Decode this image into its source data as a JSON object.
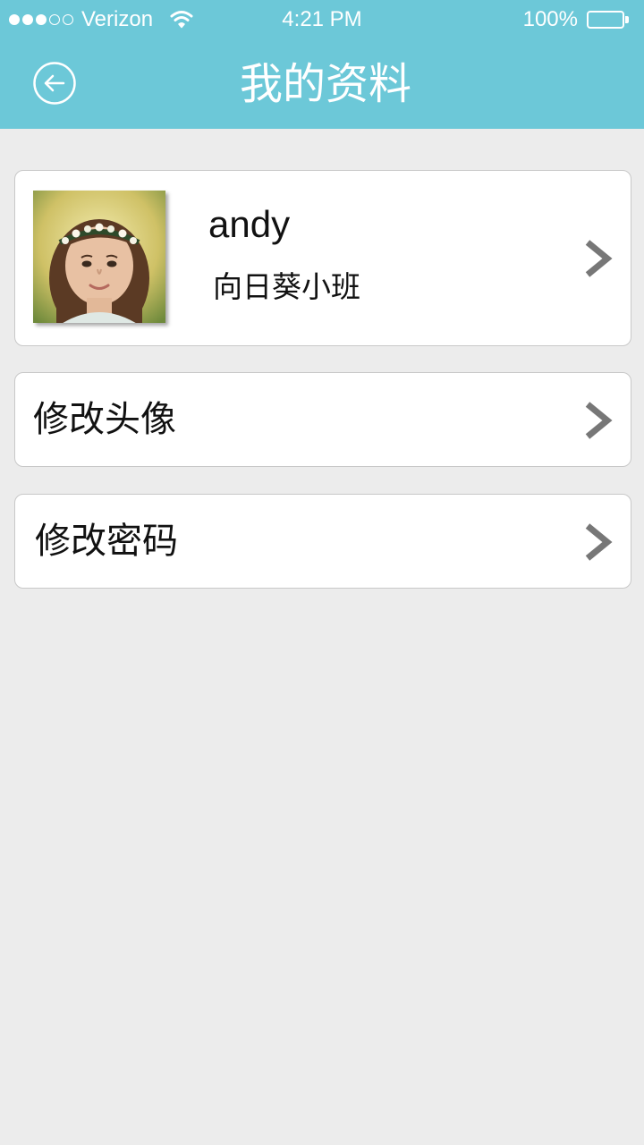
{
  "status_bar": {
    "carrier": "Verizon",
    "signal_bars_filled": 3,
    "signal_bars_total": 5,
    "time": "4:21 PM",
    "battery": "100%"
  },
  "header": {
    "title": "我的资料",
    "back_icon": "back-arrow-circle-icon",
    "background_color": "#6cc8d8"
  },
  "profile": {
    "name": "andy",
    "class_name": "向日葵小班",
    "avatar": "avatar-photo"
  },
  "menu": {
    "items": [
      {
        "label": "修改头像",
        "icon": "chevron-right-icon"
      },
      {
        "label": "修改密码",
        "icon": "chevron-right-icon"
      }
    ]
  }
}
